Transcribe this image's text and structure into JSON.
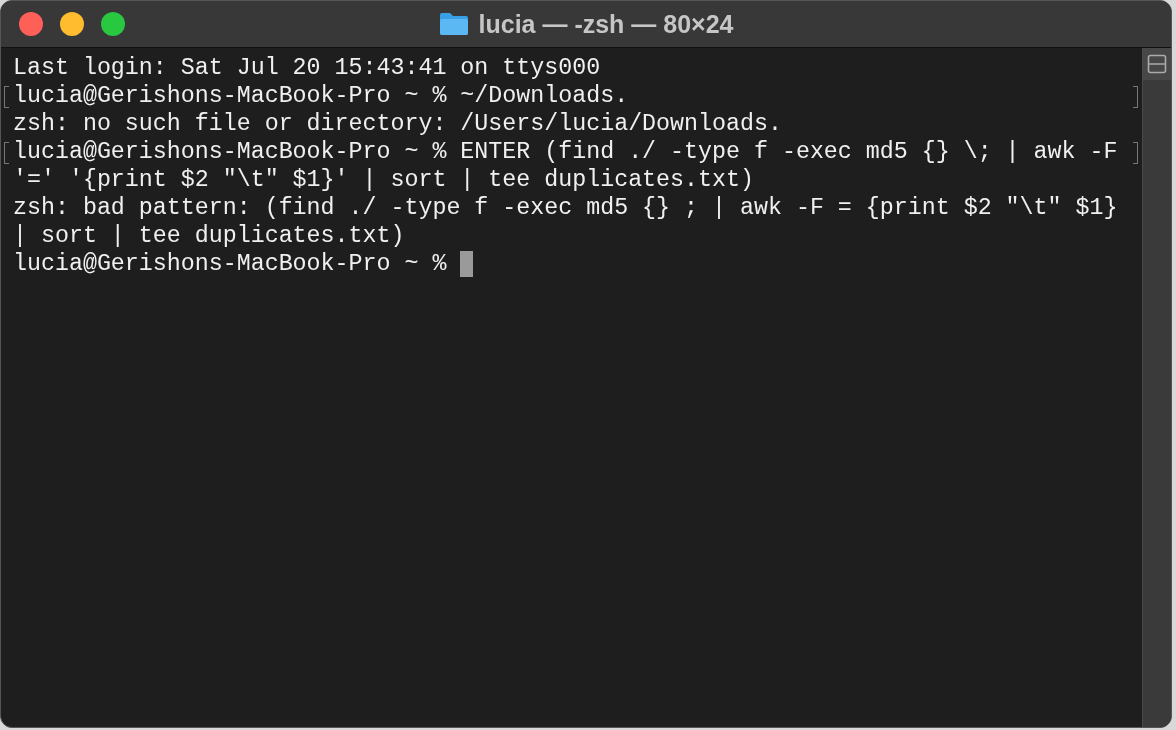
{
  "window": {
    "title": "lucia — -zsh — 80×24"
  },
  "lines": [
    {
      "text": "Last login: Sat Jul 20 15:43:41 on ttys000",
      "marked": false,
      "cursor": false
    },
    {
      "text": "lucia@Gerishons-MacBook-Pro ~ % ~/Downloads.",
      "marked": true,
      "cursor": false
    },
    {
      "text": "zsh: no such file or directory: /Users/lucia/Downloads.",
      "marked": false,
      "cursor": false
    },
    {
      "text": "lucia@Gerishons-MacBook-Pro ~ % ENTER (find ./ -type f -exec md5 {} \\; | awk -F",
      "marked": true,
      "cursor": false
    },
    {
      "text": "'=' '{print $2 \"\\t\" $1}' | sort | tee duplicates.txt)",
      "marked": false,
      "cursor": false
    },
    {
      "text": "zsh: bad pattern: (find ./ -type f -exec md5 {} ; | awk -F = {print $2 \"\\t\" $1}",
      "marked": false,
      "cursor": false
    },
    {
      "text": "| sort | tee duplicates.txt)",
      "marked": false,
      "cursor": false
    },
    {
      "text": "lucia@Gerishons-MacBook-Pro ~ % ",
      "marked": false,
      "cursor": true
    }
  ]
}
